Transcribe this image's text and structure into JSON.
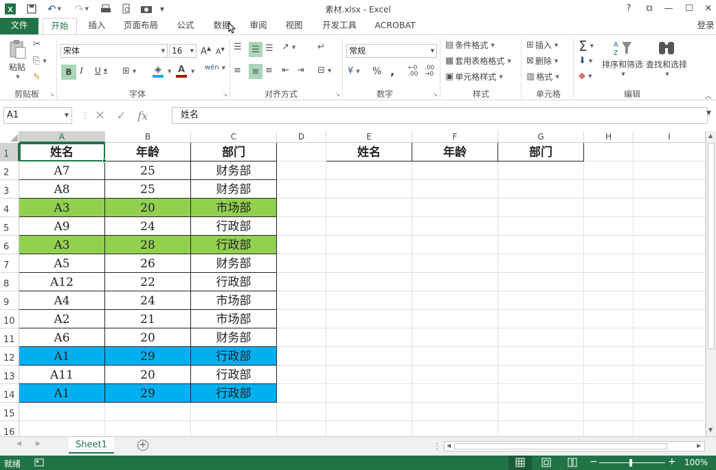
{
  "window": {
    "title": "素材.xlsx - Excel",
    "help": "?",
    "restore_ribbon": "⧉",
    "minimize": "—",
    "maximize": "☐",
    "close": "✕"
  },
  "tabs": [
    {
      "label": "文件"
    },
    {
      "label": "开始"
    },
    {
      "label": "插入"
    },
    {
      "label": "页面布局"
    },
    {
      "label": "公式"
    },
    {
      "label": "数据"
    },
    {
      "label": "审阅"
    },
    {
      "label": "视图"
    },
    {
      "label": "开发工具"
    },
    {
      "label": "ACROBAT"
    }
  ],
  "account": "登录",
  "ribbon": {
    "clipboard": {
      "paste": "粘贴",
      "label": "剪贴板"
    },
    "font": {
      "name": "宋体",
      "size": "16",
      "label": "字体",
      "bold": "B",
      "italic": "I",
      "underline": "U",
      "wen": "wén"
    },
    "alignment": {
      "label": "对齐方式"
    },
    "number": {
      "format": "常规",
      "label": "数字",
      "percent": "%",
      "comma": ","
    },
    "styles": {
      "conditional": "条件格式",
      "table": "套用表格格式",
      "cell": "单元格样式",
      "label": "样式"
    },
    "cells": {
      "insert": "插入",
      "delete": "删除",
      "format": "格式",
      "label": "单元格"
    },
    "editing": {
      "sort": "排序和筛选",
      "find": "查找和选择",
      "label": "编辑"
    }
  },
  "formula_bar": {
    "name_box": "A1",
    "formula": "姓名",
    "fx": "fx"
  },
  "columns": [
    "A",
    "B",
    "C",
    "D",
    "E",
    "F",
    "G",
    "H",
    "I"
  ],
  "rows": [
    "1",
    "2",
    "3",
    "4",
    "5",
    "6",
    "7",
    "8",
    "9",
    "10",
    "11",
    "12",
    "13",
    "14",
    "15",
    "16"
  ],
  "table": {
    "headers": [
      "姓名",
      "年龄",
      "部门"
    ],
    "data": [
      [
        "A7",
        "25",
        "财务部"
      ],
      [
        "A8",
        "25",
        "财务部"
      ],
      [
        "A3",
        "20",
        "市场部"
      ],
      [
        "A9",
        "24",
        "行政部"
      ],
      [
        "A3",
        "28",
        "行政部"
      ],
      [
        "A5",
        "26",
        "财务部"
      ],
      [
        "A12",
        "22",
        "行政部"
      ],
      [
        "A4",
        "24",
        "市场部"
      ],
      [
        "A2",
        "21",
        "市场部"
      ],
      [
        "A6",
        "20",
        "财务部"
      ],
      [
        "A1",
        "29",
        "行政部"
      ],
      [
        "A11",
        "20",
        "行政部"
      ],
      [
        "A1",
        "29",
        "行政部"
      ]
    ],
    "row_fills": [
      "",
      "",
      "#92d050",
      "",
      "#92d050",
      "",
      "",
      "",
      "",
      "",
      "#00b0f0",
      "",
      "#00b0f0"
    ]
  },
  "result_headers": [
    "姓名",
    "年龄",
    "部门"
  ],
  "sheet_tab": "Sheet1",
  "status": {
    "ready": "就绪",
    "zoom": "100%"
  },
  "colors": {
    "accent": "#217346",
    "green_fill": "#92d050",
    "blue_fill": "#00b0f0"
  }
}
